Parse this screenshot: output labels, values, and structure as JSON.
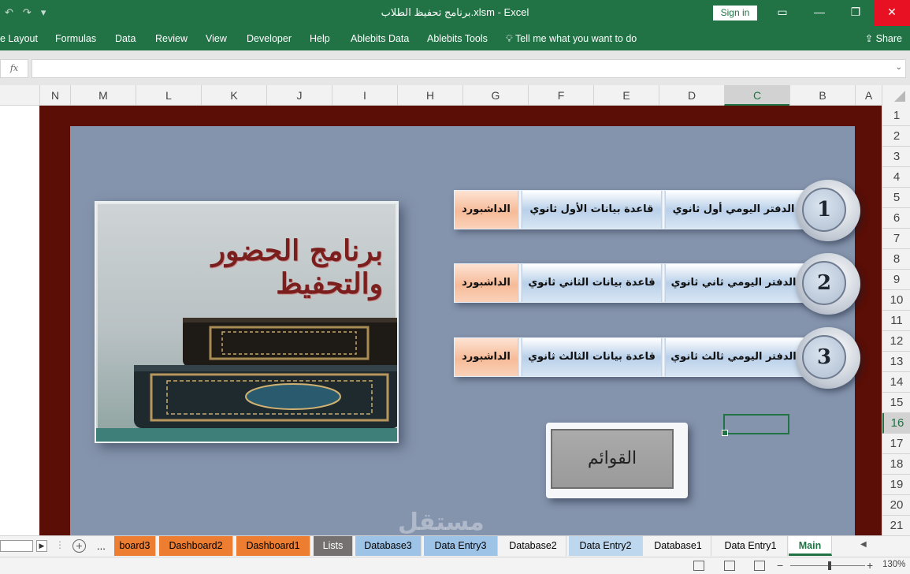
{
  "window": {
    "title": "برنامج تحفيظ الطلاب.xlsm  -  Excel",
    "signin_label": "Sign in",
    "qat_undo": "↶",
    "qat_redo": "↷",
    "qat_custom": "▾"
  },
  "ribbon": {
    "tabs": [
      "e Layout",
      "Formulas",
      "Data",
      "Review",
      "View",
      "Developer",
      "Help",
      "Ablebits Data",
      "Ablebits Tools",
      "Tell me what you want to do"
    ],
    "share_label": "Share"
  },
  "formula_bar": {
    "fx_label": "fx",
    "value": ""
  },
  "columns": [
    "N",
    "M",
    "L",
    "K",
    "J",
    "I",
    "H",
    "G",
    "F",
    "E",
    "D",
    "C",
    "B",
    "A"
  ],
  "selected_column": "C",
  "rows": [
    "1",
    "2",
    "3",
    "4",
    "5",
    "6",
    "7",
    "8",
    "9",
    "10",
    "11",
    "12",
    "13",
    "14",
    "15",
    "16",
    "17",
    "18",
    "19",
    "20",
    "21"
  ],
  "selected_row": "16",
  "dashboard": {
    "card_title": "برنامج الحضور والتحفيظ",
    "menu_rows": [
      {
        "number": "1",
        "daily": "الدفتر اليومي أول ثانوي",
        "database": "قاعدة بيانات الأول ثانوي",
        "dashboard": "الداشبورد"
      },
      {
        "number": "2",
        "daily": "الدفتر اليومي ثاني ثانوي",
        "database": "قاعدة بيانات الثاني ثانوي",
        "dashboard": "الداشبورد"
      },
      {
        "number": "3",
        "daily": "الدفتر اليومي ثالث ثانوي",
        "database": "قاعدة بيانات الثالث ثانوي",
        "dashboard": "الداشبورد"
      }
    ],
    "lists_button": "القوائم"
  },
  "sheet_tabs": [
    {
      "label": "board3",
      "color": "#ed7d31"
    },
    {
      "label": "Dashboard2",
      "color": "#ed7d31"
    },
    {
      "label": "Dashboard1",
      "color": "#ed7d31"
    },
    {
      "label": "Lists",
      "color": "#767171"
    },
    {
      "label": "Database3",
      "color": "#9dc3e6"
    },
    {
      "label": "Data Entry3",
      "color": "#9dc3e6"
    },
    {
      "label": "Database2",
      "color": "#f3f3f3"
    },
    {
      "label": "Data Entry2",
      "color": "#bdd7ee"
    },
    {
      "label": "Database1",
      "color": "#f3f3f3"
    },
    {
      "label": "Data Entry1",
      "color": "#f3f3f3"
    },
    {
      "label": "Main",
      "color": "#ffffff"
    }
  ],
  "sheet_more": "...",
  "status": {
    "zoom": "130%",
    "zoom_fraction": 0.53
  },
  "watermark": "مستقل"
}
